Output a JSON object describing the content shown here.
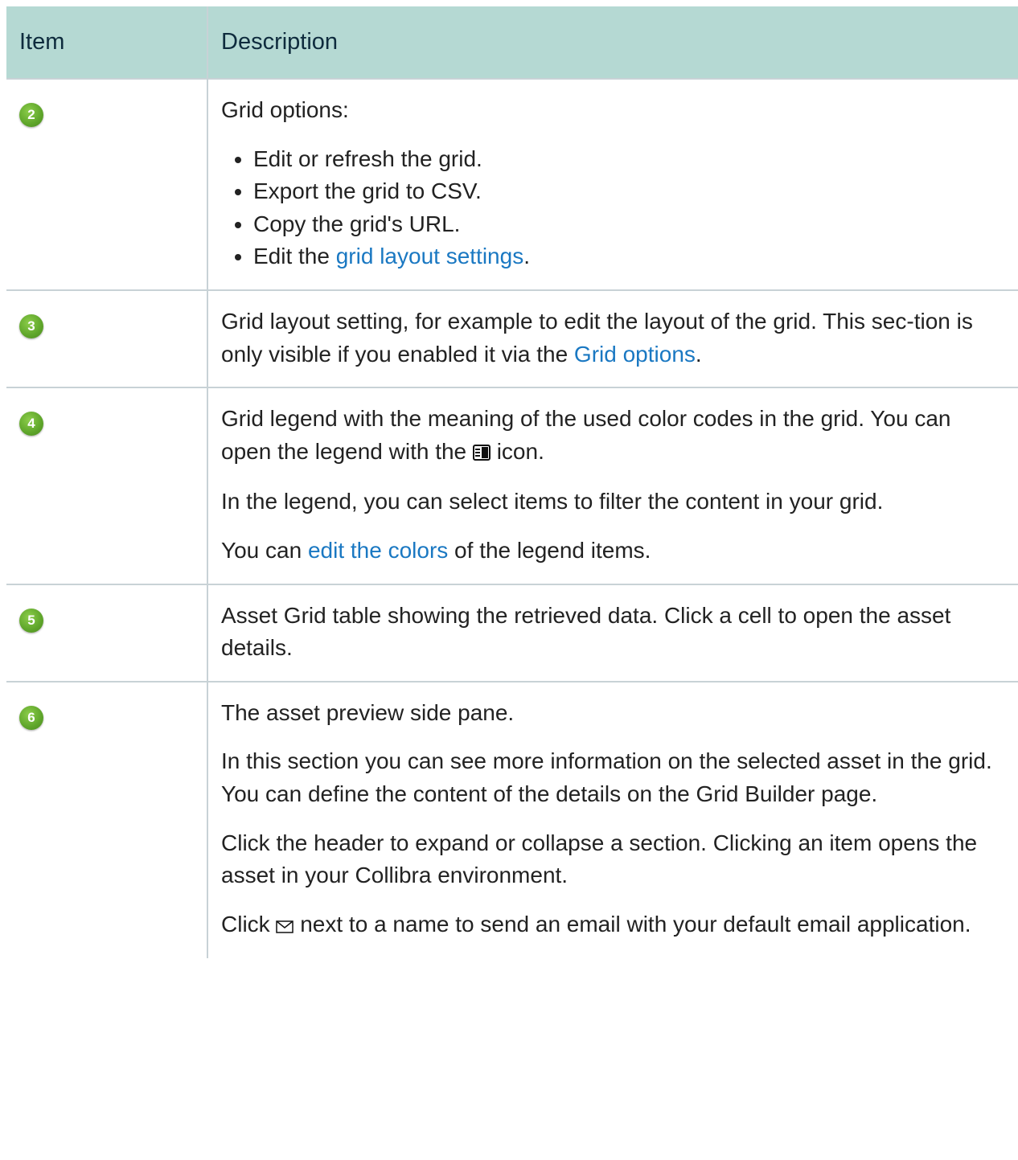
{
  "table": {
    "header_item": "Item",
    "header_description": "Description"
  },
  "rows": [
    {
      "badge": "2",
      "intro": "Grid options:",
      "bullets": [
        "Edit or refresh the grid.",
        "Export the grid to CSV.",
        "Copy the grid's URL."
      ],
      "bullet4_prefix": "Edit the ",
      "bullet4_link": "grid layout settings",
      "bullet4_suffix": "."
    },
    {
      "badge": "3",
      "text_prefix": "Grid layout setting, for example to edit the layout of the grid. This sec-tion is only visible if you enabled it via the ",
      "link": "Grid options",
      "text_suffix": "."
    },
    {
      "badge": "4",
      "p1_prefix": "Grid legend with the meaning of the used color codes in the grid. You can open the legend with the ",
      "p1_icon": "legend-icon",
      "p1_suffix": " icon.",
      "p2": "In the legend, you can select items to filter the content in your grid.",
      "p3_prefix": "You can ",
      "p3_link": "edit the colors",
      "p3_suffix": " of the legend items."
    },
    {
      "badge": "5",
      "text": "Asset Grid table showing the retrieved data. Click a cell to open the asset details."
    },
    {
      "badge": "6",
      "p1": "The asset preview side pane.",
      "p2": "In this section you can see more information on the selected asset in the grid. You can define the content of the details on the Grid Builder page.",
      "p3": "Click the header to expand or collapse a section. Clicking an item opens the asset in your Collibra environment.",
      "p4_prefix": "Click ",
      "p4_icon": "envelope-icon",
      "p4_suffix": " next to a name to send an email with your default email application."
    }
  ],
  "colors": {
    "header_bg": "#b5d9d3",
    "link": "#1a78c2",
    "badge": "#5ea52a"
  }
}
